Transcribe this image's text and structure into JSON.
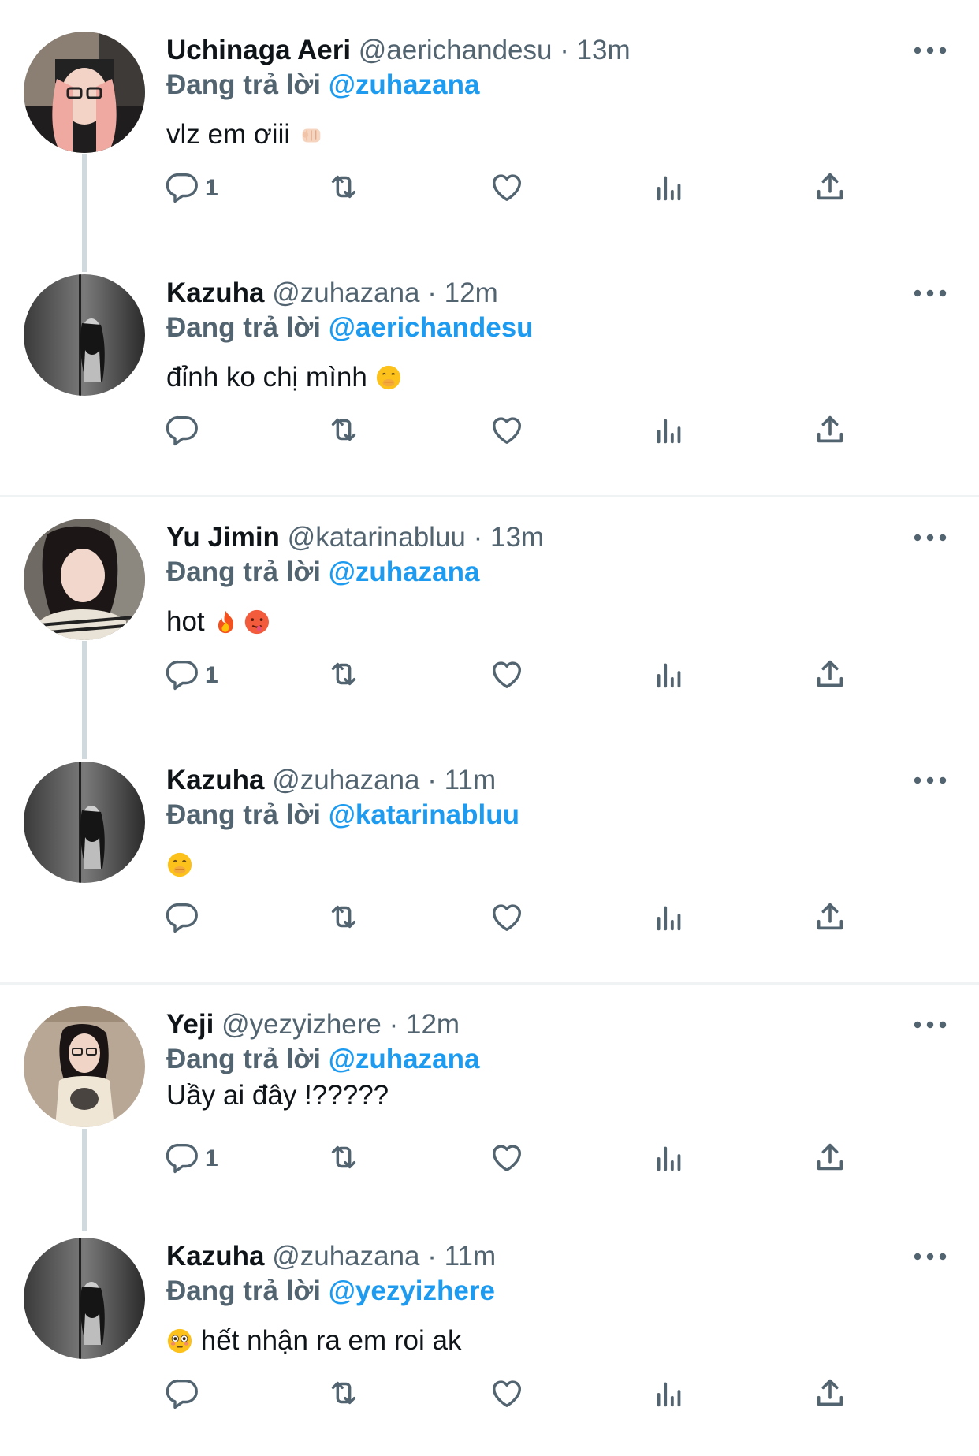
{
  "colors": {
    "accent": "#1d9bf0",
    "muted": "#536471",
    "text": "#0f1419",
    "line": "#cfd9de"
  },
  "reply_prefix": "Đang trả lời",
  "icons": [
    "reply-icon",
    "retweet-icon",
    "like-icon",
    "views-icon",
    "share-icon",
    "more-icon"
  ],
  "tweets": [
    {
      "name": "Uchinaga Aeri",
      "handle": "@aerichandesu",
      "time": "· 13m",
      "reply_to": "@zuhazana",
      "text": "vlz em ơiii",
      "emoji": "fist-bump-emoji",
      "reply_count": "1",
      "avatar": "aeri-avatar"
    },
    {
      "name": "Kazuha",
      "handle": "@zuhazana",
      "time": "· 12m",
      "reply_to": "@aerichandesu",
      "text": "đỉnh ko chị mình",
      "emoji": "hand-over-mouth-emoji",
      "reply_count": "",
      "avatar": "kazuha-avatar"
    },
    {
      "name": "Yu Jimin",
      "handle": "@katarinabluu",
      "time": "· 13m",
      "reply_to": "@zuhazana",
      "text": "hot",
      "emoji": "fire-hot-face-emoji",
      "reply_count": "1",
      "avatar": "jimin-avatar"
    },
    {
      "name": "Kazuha",
      "handle": "@zuhazana",
      "time": "· 11m",
      "reply_to": "@katarinabluu",
      "text": "",
      "emoji": "hand-over-mouth-emoji",
      "reply_count": "",
      "avatar": "kazuha-avatar"
    },
    {
      "name": "Yeji",
      "handle": "@yezyizhere",
      "time": "· 12m",
      "reply_to": "@zuhazana",
      "text": "Uầy ai đây !?????",
      "emoji": "",
      "reply_count": "1",
      "avatar": "yeji-avatar"
    },
    {
      "name": "Kazuha",
      "handle": "@zuhazana",
      "time": "· 11m",
      "reply_to": "@yezyizhere",
      "text": "hết nhận ra em roi ak",
      "emoji": "flushed-face-emoji",
      "reply_count": "",
      "avatar": "kazuha-avatar"
    }
  ]
}
